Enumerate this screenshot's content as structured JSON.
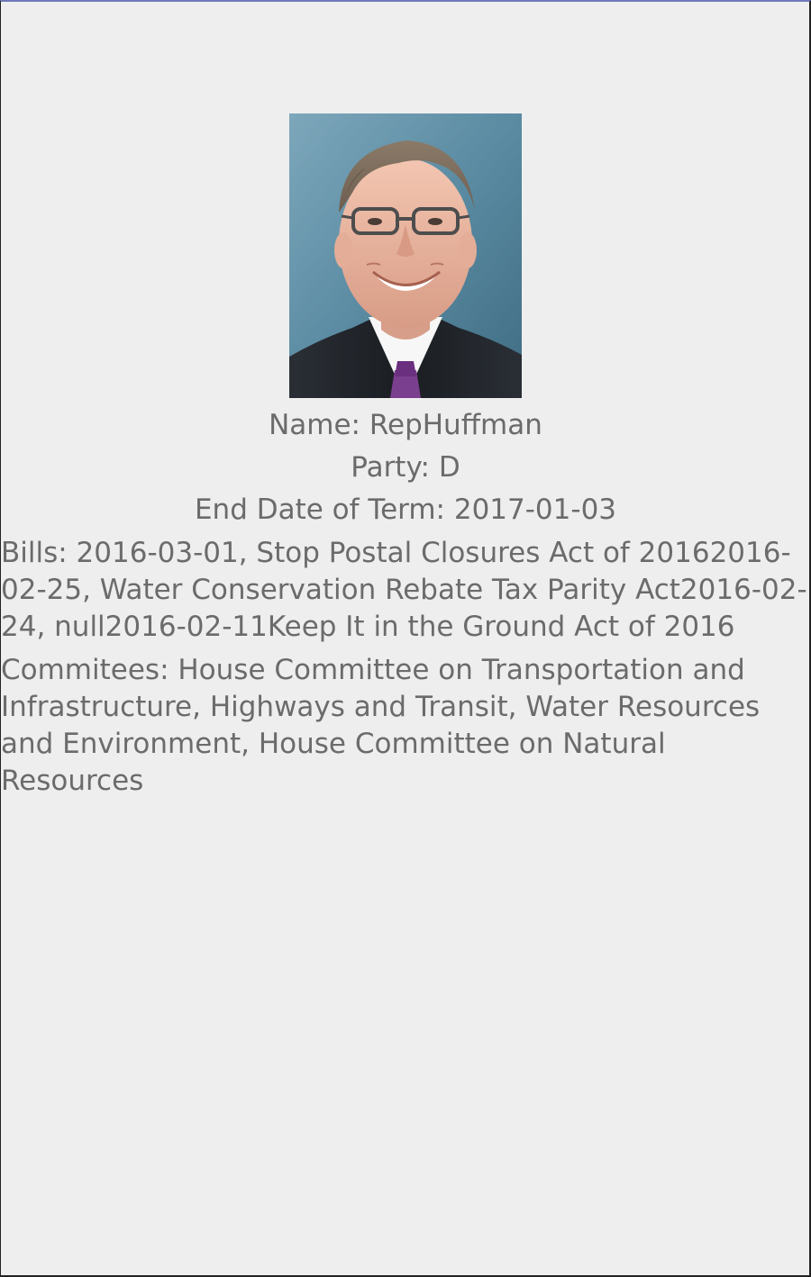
{
  "profile": {
    "photo_label": "representative-portrait",
    "name": "Name: RepHuffman",
    "party": "Party: D",
    "end_date": "End Date of Term: 2017-01-03",
    "bills": "Bills: 2016-03-01, Stop Postal Closures Act of 20162016-02-25, Water Conservation Rebate Tax Parity Act2016-02-24, null2016-02-11Keep It in the Ground Act of 2016",
    "committees": "Commitees: House Committee on Transportation and Infrastructure, Highways and Transit, Water Resources and Environment, House Committee on Natural Resources"
  }
}
